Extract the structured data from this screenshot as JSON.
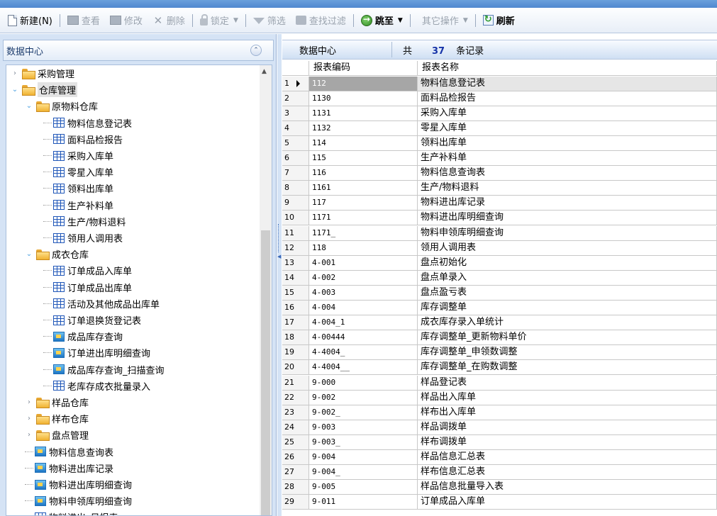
{
  "toolbar": {
    "items": [
      {
        "label": "新建(N)",
        "icon": "new-doc-icon",
        "enabled": true
      },
      {
        "label": "查看",
        "icon": "view-icon",
        "enabled": false
      },
      {
        "label": "修改",
        "icon": "edit-icon",
        "enabled": false
      },
      {
        "label": "删除",
        "icon": "delete-icon",
        "enabled": false
      },
      {
        "label": "锁定",
        "icon": "lock-icon",
        "enabled": false
      },
      {
        "label": "筛选",
        "icon": "filter-icon",
        "enabled": false
      },
      {
        "label": "查找过滤",
        "icon": "find-filter-icon",
        "enabled": false
      },
      {
        "label": "跳至",
        "icon": "goto-icon",
        "enabled": true
      },
      {
        "label": "其它操作",
        "enabled": false
      },
      {
        "label": "刷新",
        "icon": "refresh-icon",
        "enabled": true
      }
    ]
  },
  "left": {
    "title": "数据中心",
    "tree": [
      {
        "label": "采购管理",
        "type": "folder",
        "level": 0,
        "state": "collapsed"
      },
      {
        "label": "仓库管理",
        "type": "folder",
        "level": 0,
        "state": "expanded",
        "selected": true
      },
      {
        "label": "原物料仓库",
        "type": "folder",
        "level": 1,
        "state": "expanded"
      },
      {
        "label": "物料信息登记表",
        "type": "table",
        "level": 2
      },
      {
        "label": "面料品检报告",
        "type": "table",
        "level": 2
      },
      {
        "label": "采购入库单",
        "type": "table",
        "level": 2
      },
      {
        "label": "零星入库单",
        "type": "table",
        "level": 2
      },
      {
        "label": "领料出库单",
        "type": "table",
        "level": 2
      },
      {
        "label": "生产补料单",
        "type": "table",
        "level": 2
      },
      {
        "label": "生产/物料退料",
        "type": "table",
        "level": 2
      },
      {
        "label": "领用人调用表",
        "type": "table",
        "level": 2
      },
      {
        "label": "成衣仓库",
        "type": "folder",
        "level": 1,
        "state": "expanded"
      },
      {
        "label": "订单成品入库单",
        "type": "table",
        "level": 2
      },
      {
        "label": "订单成品出库单",
        "type": "table",
        "level": 2
      },
      {
        "label": "活动及其他成品出库单",
        "type": "table",
        "level": 2
      },
      {
        "label": "订单退换货登记表",
        "type": "table",
        "level": 2
      },
      {
        "label": "成品库存查询",
        "type": "query",
        "level": 2
      },
      {
        "label": "订单进出库明细查询",
        "type": "query",
        "level": 2
      },
      {
        "label": "成品库存查询_扫描查询",
        "type": "query",
        "level": 2
      },
      {
        "label": "老库存成衣批量录入",
        "type": "table",
        "level": 2
      },
      {
        "label": "样品仓库",
        "type": "folder",
        "level": 1,
        "state": "collapsed"
      },
      {
        "label": "样布仓库",
        "type": "folder",
        "level": 1,
        "state": "collapsed"
      },
      {
        "label": "盘点管理",
        "type": "folder",
        "level": 1,
        "state": "collapsed"
      },
      {
        "label": "物料信息查询表",
        "type": "query",
        "level": 1
      },
      {
        "label": "物料进出库记录",
        "type": "query",
        "level": 1
      },
      {
        "label": "物料进出库明细查询",
        "type": "query",
        "level": 1
      },
      {
        "label": "物料申领库明细查询",
        "type": "query",
        "level": 1
      },
      {
        "label": "物料进出_日报表",
        "type": "table",
        "level": 1
      }
    ]
  },
  "grid": {
    "title": "数据中心",
    "count_prefix": "共",
    "count": "37",
    "count_suffix": "条记录",
    "columns": [
      "报表编码",
      "报表名称"
    ],
    "rows": [
      {
        "n": "1",
        "code": "112",
        "name": "物料信息登记表",
        "selected": true
      },
      {
        "n": "2",
        "code": "1130",
        "name": "面料品检报告"
      },
      {
        "n": "3",
        "code": "1131",
        "name": "采购入库单"
      },
      {
        "n": "4",
        "code": "1132",
        "name": "零星入库单"
      },
      {
        "n": "5",
        "code": "114",
        "name": "领料出库单"
      },
      {
        "n": "6",
        "code": "115",
        "name": "生产补料单"
      },
      {
        "n": "7",
        "code": "116",
        "name": "物料信息查询表"
      },
      {
        "n": "8",
        "code": "1161",
        "name": "生产/物料退料"
      },
      {
        "n": "9",
        "code": "117",
        "name": "物料进出库记录"
      },
      {
        "n": "10",
        "code": "1171",
        "name": "物料进出库明细查询"
      },
      {
        "n": "11",
        "code": "1171_",
        "name": "物料申领库明细查询"
      },
      {
        "n": "12",
        "code": "118",
        "name": "领用人调用表"
      },
      {
        "n": "13",
        "code": "4-001",
        "name": "盘点初始化"
      },
      {
        "n": "14",
        "code": "4-002",
        "name": "盘点单录入"
      },
      {
        "n": "15",
        "code": "4-003",
        "name": "盘点盈亏表"
      },
      {
        "n": "16",
        "code": "4-004",
        "name": "库存调整单"
      },
      {
        "n": "17",
        "code": "4-004_1",
        "name": "成衣库存录入单统计"
      },
      {
        "n": "18",
        "code": "4-00444",
        "name": "库存调整单_更新物料单价"
      },
      {
        "n": "19",
        "code": "4-4004_",
        "name": "库存调整单_申领数调整"
      },
      {
        "n": "20",
        "code": "4-4004__",
        "name": "库存调整单_在购数调整"
      },
      {
        "n": "21",
        "code": "9-000",
        "name": "样品登记表"
      },
      {
        "n": "22",
        "code": "9-002",
        "name": "样品出入库单"
      },
      {
        "n": "23",
        "code": "9-002_",
        "name": "样布出入库单"
      },
      {
        "n": "24",
        "code": "9-003",
        "name": "样品调拨单"
      },
      {
        "n": "25",
        "code": "9-003_",
        "name": "样布调拨单"
      },
      {
        "n": "26",
        "code": "9-004",
        "name": "样品信息汇总表"
      },
      {
        "n": "27",
        "code": "9-004_",
        "name": "样布信息汇总表"
      },
      {
        "n": "28",
        "code": "9-005",
        "name": "样品信息批量导入表"
      },
      {
        "n": "29",
        "code": "9-011",
        "name": "订单成品入库单"
      }
    ]
  }
}
